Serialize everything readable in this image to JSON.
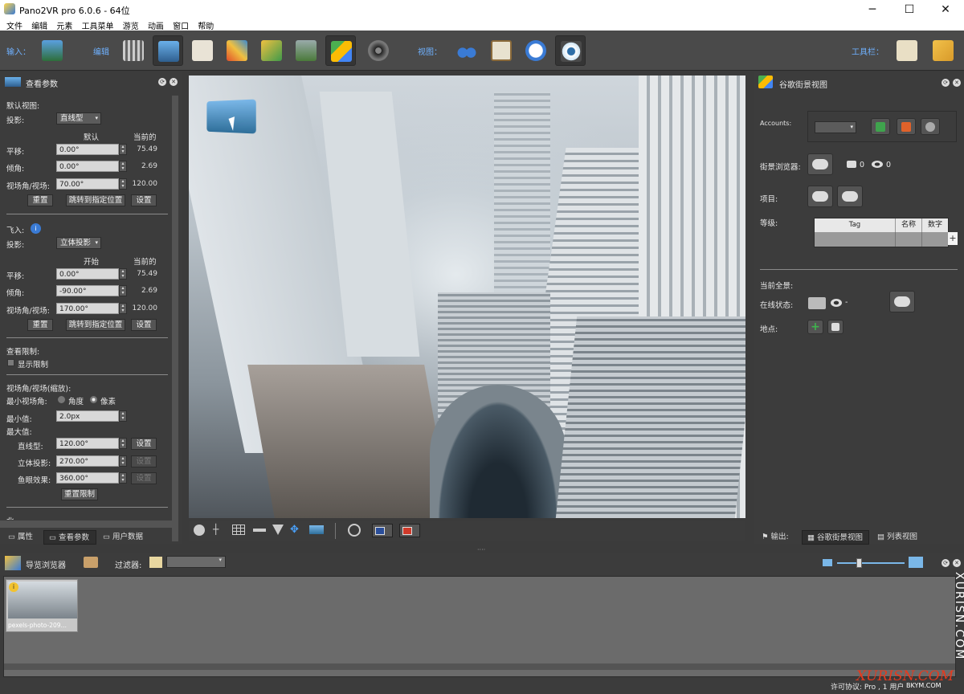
{
  "titlebar": {
    "title": "Pano2VR pro 6.0.6 - 64位",
    "minimize": "─",
    "maximize": "☐",
    "close": "✕"
  },
  "menu": [
    "文件",
    "编辑",
    "元素",
    "工具菜单",
    "游览",
    "动画",
    "窗口",
    "帮助"
  ],
  "toolbar": {
    "input_label": "输入：",
    "edit_label": "编辑",
    "view_label": "视图：",
    "tools_label": "工具栏："
  },
  "left_panel": {
    "title": "查看参数",
    "default_view": {
      "heading": "默认视图:",
      "projection_label": "投影:",
      "projection_value": "直线型",
      "col_default": "默认",
      "col_current": "当前的",
      "pan_label": "平移:",
      "pan_value": "0.00°",
      "pan_current": "75.49",
      "tilt_label": "倾角:",
      "tilt_value": "0.00°",
      "tilt_current": "2.69",
      "fov_label": "视场角/视场:",
      "fov_value": "70.00°",
      "fov_current": "120.00",
      "reset": "重置",
      "jump": "跳转到指定位置",
      "set": "设置"
    },
    "fly_in": {
      "heading": "飞入:",
      "projection_label": "投影:",
      "projection_value": "立体投影",
      "col_start": "开始",
      "col_current": "当前的",
      "pan_label": "平移:",
      "pan_value": "0.00°",
      "pan_current": "75.49",
      "tilt_label": "倾角:",
      "tilt_value": "-90.00°",
      "tilt_current": "2.69",
      "fov_label": "视场角/视场:",
      "fov_value": "170.00°",
      "fov_current": "120.00",
      "reset": "重置",
      "jump": "跳转到指定位置",
      "set": "设置"
    },
    "limits": {
      "heading": "查看限制:",
      "show_limits": "显示限制"
    },
    "zoom": {
      "heading": "视场角/视场(缩放):",
      "min_fov_label": "最小视场角:",
      "opt_angle": "角度",
      "opt_pixel": "像素",
      "min_label": "最小值:",
      "min_value": "2.0px",
      "max_label": "最大值:",
      "rect_label": "直线型:",
      "rect_value": "120.00°",
      "rect_set": "设置",
      "stereo_label": "立体投影:",
      "stereo_value": "270.00°",
      "stereo_set": "设置",
      "fisheye_label": "鱼眼效果:",
      "fisheye_value": "360.00°",
      "fisheye_set": "设置",
      "reset_limits": "重置限制"
    },
    "cut_label": "北:",
    "tabs": [
      "属性",
      "查看参数",
      "用户数据"
    ]
  },
  "right_panel": {
    "title": "谷歌街景视图",
    "accounts_label": "Accounts:",
    "browser_label": "街景浏览器:",
    "photo_count": "0",
    "view_count": "0",
    "project_label": "项目:",
    "level_label": "等级:",
    "table_headers": [
      "Tag",
      "名称",
      "数字"
    ],
    "current_label": "当前全景:",
    "online_label": "在线状态:",
    "online_value": "-",
    "place_label": "地点:",
    "tabs": [
      "输出:",
      "谷歌街景视图",
      "列表视图"
    ]
  },
  "bottom": {
    "title": "导览浏览器",
    "filter_label": "过滤器:",
    "thumb_caption": "pexels-photo-209…",
    "license": "许可协议: Pro , 1 用户"
  },
  "watermark": {
    "side": "XURISN.COM",
    "bottom": "XURISN.COM",
    "url": "BKYM.COM"
  }
}
